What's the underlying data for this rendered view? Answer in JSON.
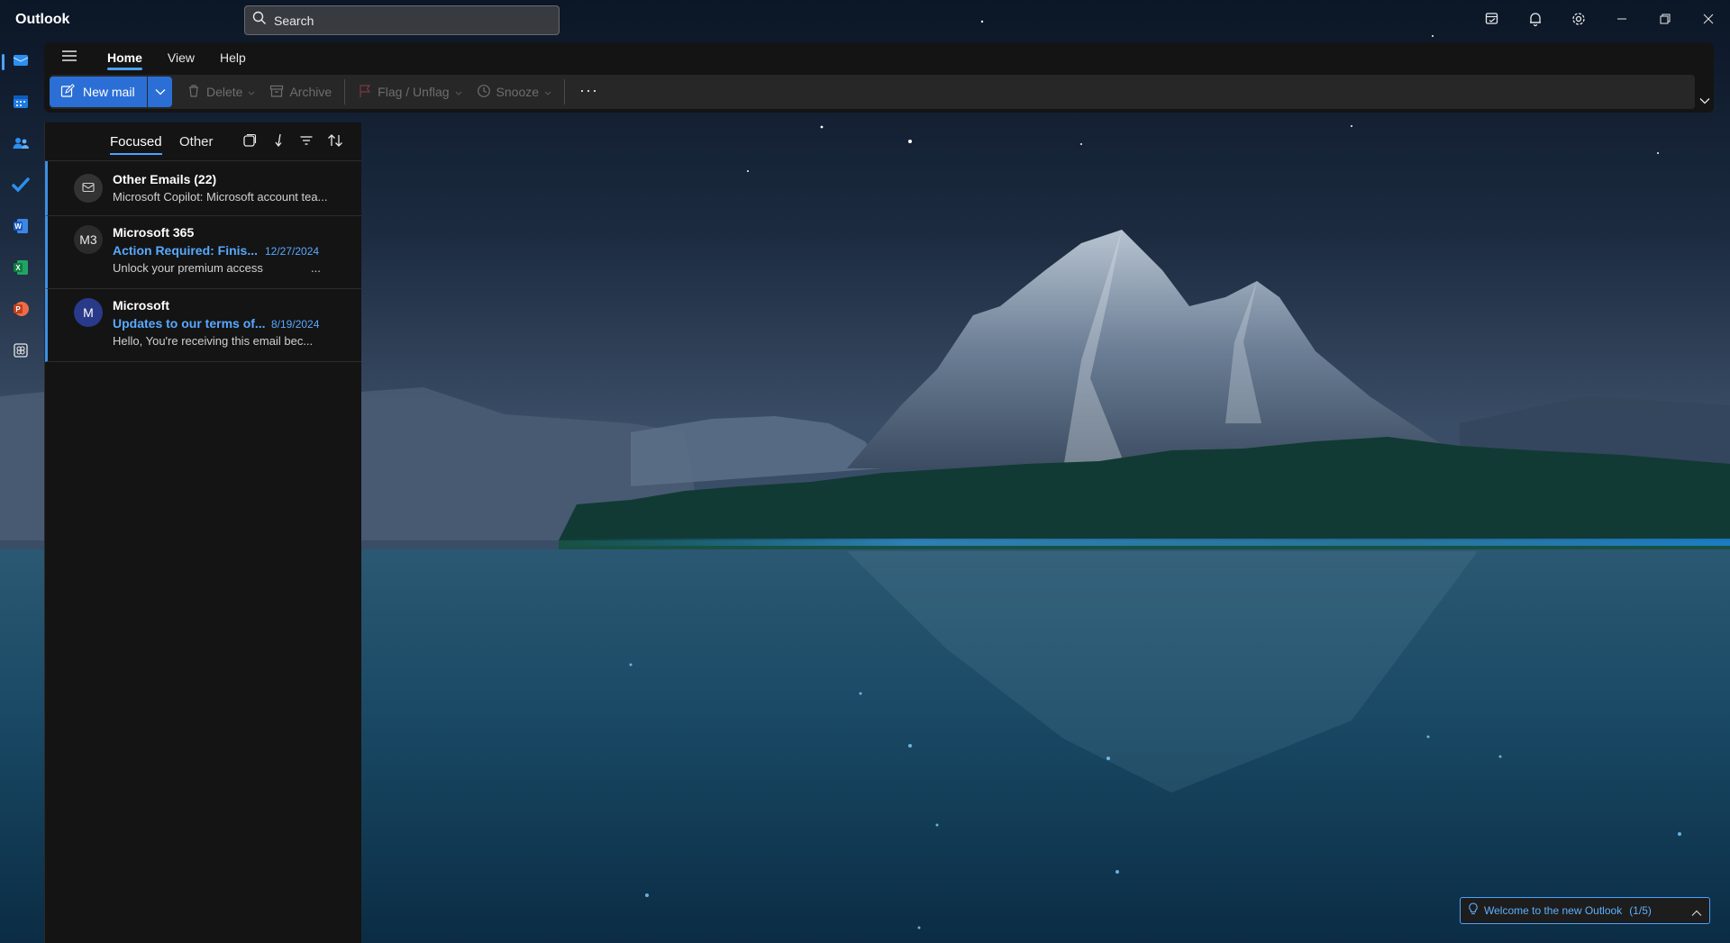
{
  "app": {
    "title": "Outlook"
  },
  "search": {
    "placeholder": "Search"
  },
  "ribbon": {
    "tabs": [
      {
        "label": "Home",
        "active": true
      },
      {
        "label": "View",
        "active": false
      },
      {
        "label": "Help",
        "active": false
      }
    ],
    "new_mail_label": "New mail",
    "delete_label": "Delete",
    "archive_label": "Archive",
    "flag_label": "Flag / Unflag",
    "snooze_label": "Snooze",
    "more_label": "···"
  },
  "rail": {
    "items": [
      {
        "name": "mail-icon",
        "active": true
      },
      {
        "name": "calendar-icon",
        "active": false
      },
      {
        "name": "people-icon",
        "active": false
      },
      {
        "name": "todo-icon",
        "active": false
      },
      {
        "name": "word-icon",
        "active": false
      },
      {
        "name": "excel-icon",
        "active": false
      },
      {
        "name": "powerpoint-icon",
        "active": false
      },
      {
        "name": "apps-icon",
        "active": false
      }
    ]
  },
  "list": {
    "tabs": [
      {
        "label": "Focused",
        "active": true
      },
      {
        "label": "Other",
        "active": false
      }
    ],
    "messages": [
      {
        "sender": "Other Emails (22)",
        "subject": "",
        "date": "",
        "preview": "Microsoft Copilot: Microsoft account tea...",
        "avatar": "envelope"
      },
      {
        "sender": "Microsoft 365",
        "subject": "Action Required: Finis...",
        "date": "12/27/2024",
        "preview": "Unlock your premium access",
        "preview_suffix": "...",
        "avatar": "M3"
      },
      {
        "sender": "Microsoft",
        "subject": "Updates to our terms of...",
        "date": "8/19/2024",
        "preview": "Hello, You're receiving this email bec...",
        "avatar": "M"
      }
    ]
  },
  "welcome": {
    "text": "Welcome to the new Outlook",
    "count": "(1/5)"
  },
  "colors": {
    "accent": "#2b6fd6",
    "link": "#58a9ff",
    "pane": "#141414"
  }
}
